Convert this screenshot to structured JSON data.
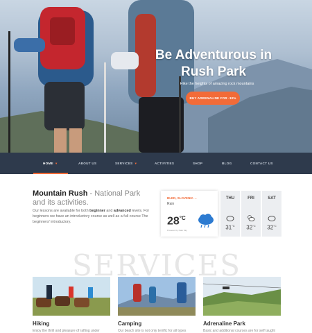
{
  "hero": {
    "title_line1": "Be Adventurous in",
    "title_line2": "Rush Park",
    "subtitle": "Hike the heights of amazing rock mountains",
    "cta_label": "BUY ADRENALINE FOR -10%"
  },
  "nav": {
    "items": [
      {
        "label": "HOME"
      },
      {
        "label": "ABOUT US"
      },
      {
        "label": "SERVICES"
      },
      {
        "label": "ACTIVITIES"
      },
      {
        "label": "SHOP"
      },
      {
        "label": "BLOG"
      },
      {
        "label": "CONTACT US"
      }
    ]
  },
  "intro": {
    "title_bold": "Mountain Rush",
    "title_rest": " - National Park and its activities.",
    "text_1": "Our lessons are available for both ",
    "text_b1": "beginner",
    "text_2": " and ",
    "text_b2": "advanced",
    "text_3": " levels. For beginners we have an introductory course as well as a full course The beginners' introductory."
  },
  "weather": {
    "location": "BLED, SLOVENIA",
    "condition": "Rain",
    "temp": "28",
    "unit": "°C",
    "powered": "Powered by Dark Sky",
    "forecast": [
      {
        "day": "THU",
        "temp": "31",
        "unit": "°C"
      },
      {
        "day": "FRI",
        "temp": "32",
        "unit": "°C"
      },
      {
        "day": "SAT",
        "temp": "32",
        "unit": "°C"
      }
    ]
  },
  "services": {
    "heading": "SERVICES",
    "cards": [
      {
        "title": "Hiking",
        "text": "Enjoy the thrill and pleasure of rafting under"
      },
      {
        "title": "Camping",
        "text": "Our beach site is not only terrific for all types"
      },
      {
        "title": "Adrenaline Park",
        "text": "Basic and additional courses are for self taught"
      }
    ]
  }
}
